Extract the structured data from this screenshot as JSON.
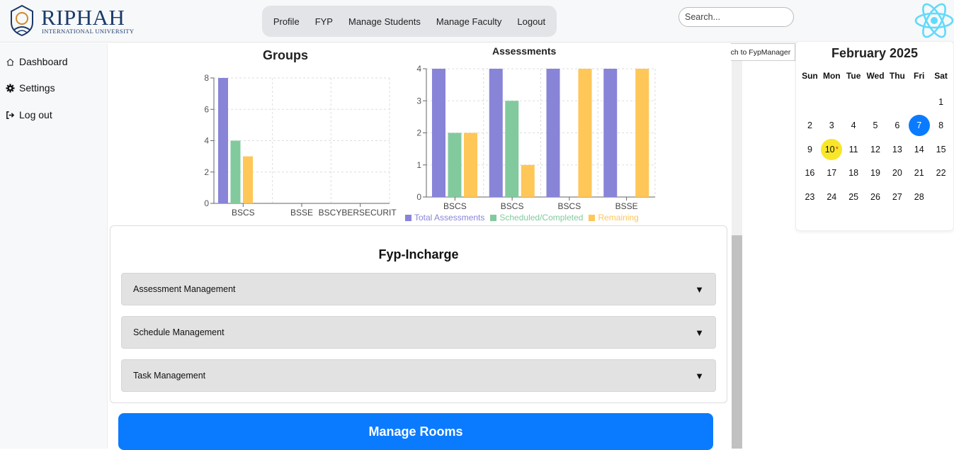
{
  "brand": {
    "name": "RIPHAH",
    "subtitle": "INTERNATIONAL UNIVERSITY"
  },
  "nav": [
    "Profile",
    "FYP",
    "Manage Students",
    "Manage Faculty",
    "Logout"
  ],
  "search": {
    "placeholder": "Search..."
  },
  "switch_label": "Switch to FypManager",
  "sidebar": [
    {
      "label": "Dashboard",
      "icon": "home-icon"
    },
    {
      "label": "Settings",
      "icon": "gear-icon"
    },
    {
      "label": "Log out",
      "icon": "logout-icon"
    }
  ],
  "colors": {
    "total": "#8884d8",
    "scheduled": "#82ca9d",
    "remaining": "#ffc658",
    "primary": "#0a7bff"
  },
  "chart_data": [
    {
      "type": "bar",
      "title": "Groups",
      "categories": [
        "BSCS",
        "BSSE",
        "BSCYBERSECURITY"
      ],
      "series": [
        {
          "values": [
            8,
            0,
            0
          ]
        },
        {
          "values": [
            4,
            0,
            0
          ]
        },
        {
          "values": [
            3,
            0,
            0
          ]
        }
      ],
      "ylim": [
        0,
        8
      ],
      "yticks": [
        0,
        2,
        4,
        6,
        8
      ],
      "grid": true
    },
    {
      "type": "bar",
      "title": "Assessments",
      "categories": [
        "BSCS",
        "BSCS",
        "BSCS",
        "BSSE"
      ],
      "series": [
        {
          "name": "Total Assessments",
          "values": [
            4,
            4,
            4,
            4
          ]
        },
        {
          "name": "Scheduled/Completed",
          "values": [
            2,
            3,
            0,
            0
          ]
        },
        {
          "name": "Remaining",
          "values": [
            2,
            1,
            4,
            4
          ]
        }
      ],
      "ylim": [
        0,
        4
      ],
      "yticks": [
        0,
        1,
        2,
        3,
        4
      ],
      "grid": true,
      "legend": "bottom"
    }
  ],
  "fyp": {
    "title": "Fyp-Incharge",
    "sections": [
      "Assessment Management",
      "Schedule Management",
      "Task Management"
    ],
    "arrow": "▼"
  },
  "rooms_button": "Manage Rooms",
  "calendar": {
    "title": "February 2025",
    "weekdays": [
      "Sun",
      "Mon",
      "Tue",
      "Wed",
      "Thu",
      "Fri",
      "Sat"
    ],
    "weeks": [
      [
        "",
        "",
        "",
        "",
        "",
        "",
        "1"
      ],
      [
        "2",
        "3",
        "4",
        "5",
        "6",
        "7",
        "8"
      ],
      [
        "9",
        "10",
        "11",
        "12",
        "13",
        "14",
        "15"
      ],
      [
        "16",
        "17",
        "18",
        "19",
        "20",
        "21",
        "22"
      ],
      [
        "23",
        "24",
        "25",
        "26",
        "27",
        "28",
        ""
      ]
    ],
    "selected": "7",
    "today": "10",
    "today_marker": "*"
  }
}
